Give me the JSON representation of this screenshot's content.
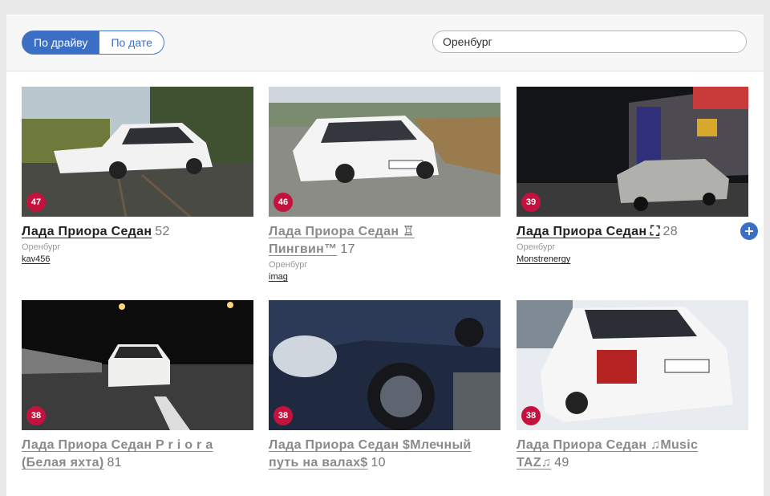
{
  "filters": {
    "by_drive": "По драйву",
    "by_date": "По дате"
  },
  "search": {
    "value": "Оренбург"
  },
  "cards": [
    {
      "title": "Лада Приора Седан",
      "count": "52",
      "city": "Оренбург",
      "user": "kav456",
      "rating": "47"
    },
    {
      "title": "Лада Приора Седан ♖ Пингвин™",
      "count": "17",
      "city": "Оренбург",
      "user": "imag",
      "rating": "46"
    },
    {
      "title": "Лада Приора Седан ⛶",
      "count": "28",
      "city": "Оренбург",
      "user": "Monstrenergy",
      "rating": "39"
    },
    {
      "title": "Лада Приора Седан P r i o r a (Белая яхта)",
      "count": "81",
      "rating": "38"
    },
    {
      "title": "Лада Приора Седан $Млечный путь на валах$",
      "count": "10",
      "rating": "38"
    },
    {
      "title": "Лада Приора Седан ♫Music TAZ♫",
      "count": "49",
      "rating": "38"
    }
  ],
  "colors": {
    "accent": "#3b6fc6",
    "badge": "#c4123f"
  },
  "icons": {
    "subscribe": "plus-circle-icon"
  }
}
